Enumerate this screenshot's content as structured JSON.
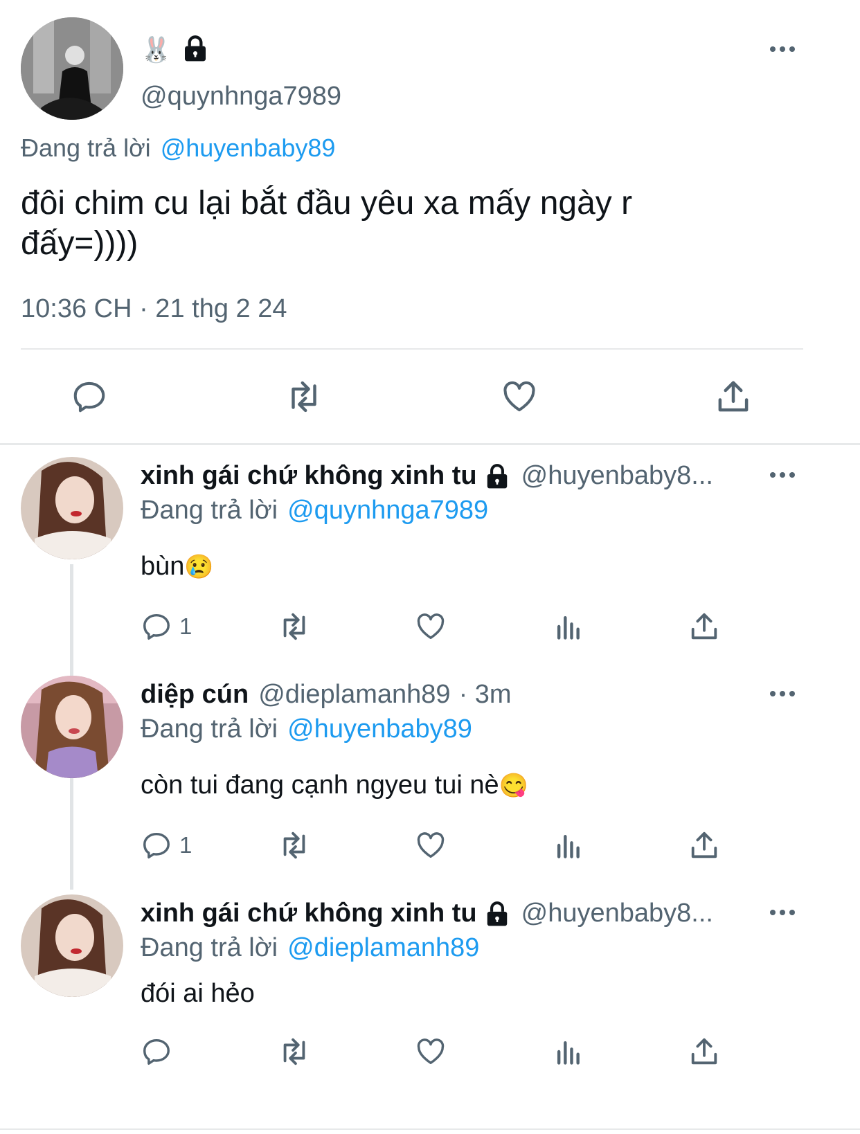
{
  "main_tweet": {
    "avatar_icon": "avatar-bw-photo",
    "display_emoji": "🐰",
    "lock_icon": "lock-icon",
    "handle": "@quynhnga7989",
    "reply_prefix": "Đang trả lời",
    "reply_to": "@huyenbaby89",
    "text_line1": "đôi chim cu lại bắt đầu yêu xa mấy ngày r",
    "text_line2": "đấy=))))",
    "timestamp": "10:36 CH · 21 thg 2 24"
  },
  "replies": [
    {
      "name": "xinh gái chứ không xinh tu",
      "handle": "@huyenbaby8...",
      "meta": "",
      "reply_prefix": "Đang trả lời",
      "reply_to": "@quynhnga7989",
      "text": "bùn",
      "emoji": "😢",
      "reply_count": "1"
    },
    {
      "name": "diệp cún",
      "handle": "@dieplamanh89",
      "meta": "· 3m",
      "reply_prefix": "Đang trả lời",
      "reply_to": "@huyenbaby89",
      "text": "còn tui đang cạnh ngyeu tui nè",
      "emoji": "😋",
      "reply_count": "1"
    },
    {
      "name": "xinh gái chứ không xinh tu",
      "handle": "@huyenbaby8...",
      "meta": "",
      "reply_prefix": "Đang trả lời",
      "reply_to": "@dieplamanh89",
      "text": "đói ai hẻo",
      "emoji": "",
      "reply_count": ""
    }
  ],
  "colors": {
    "accent": "#1d9bf0",
    "muted": "#536471",
    "divider": "#e7e9ea"
  }
}
